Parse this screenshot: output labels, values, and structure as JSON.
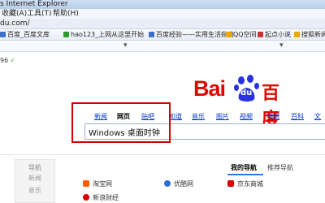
{
  "window": {
    "title": "s Internet Explorer"
  },
  "menu": {
    "items": [
      "收藏(A)",
      "工具(T)",
      "帮助(H)"
    ]
  },
  "address": {
    "text": "du.com/"
  },
  "favorites": [
    {
      "label": "百度_百度文库",
      "color": "#3b6fc9"
    },
    {
      "label": "hao123_上网从这里开始",
      "color": "#2f9a2f"
    },
    {
      "label": "百度经验——实用生活指南",
      "color": "#3b6fc9"
    },
    {
      "label": "QQ空间",
      "color": "#f0a400"
    },
    {
      "label": "起点小说",
      "color": "#c83232"
    },
    {
      "label": "搜狐新闻",
      "color": "#f0a400"
    }
  ],
  "status": {
    "text": "96"
  },
  "logo": {
    "latin": "Bai",
    "paw_text": "du",
    "chinese": "百度"
  },
  "search_tabs": [
    "新闻",
    "网页",
    "贴吧",
    "知道",
    "音乐",
    "图片",
    "视频",
    "地图",
    "百科",
    "文"
  ],
  "active_tab_index": 1,
  "search": {
    "query": "Windows 桌面时钟"
  },
  "left_nav": {
    "heading": "导航",
    "items": [
      "新闻",
      "音乐"
    ]
  },
  "nav_tabs": {
    "my_nav": "我的导航",
    "recommended": "推荐导航"
  },
  "sites": [
    {
      "label": "淘宝网",
      "color": "#ff5a00"
    },
    {
      "label": "优酷网",
      "color": "#2a6fd6"
    },
    {
      "label": "京东商城",
      "color": "#d40000"
    },
    {
      "label": "新浪财经",
      "color": "#d40000"
    }
  ]
}
